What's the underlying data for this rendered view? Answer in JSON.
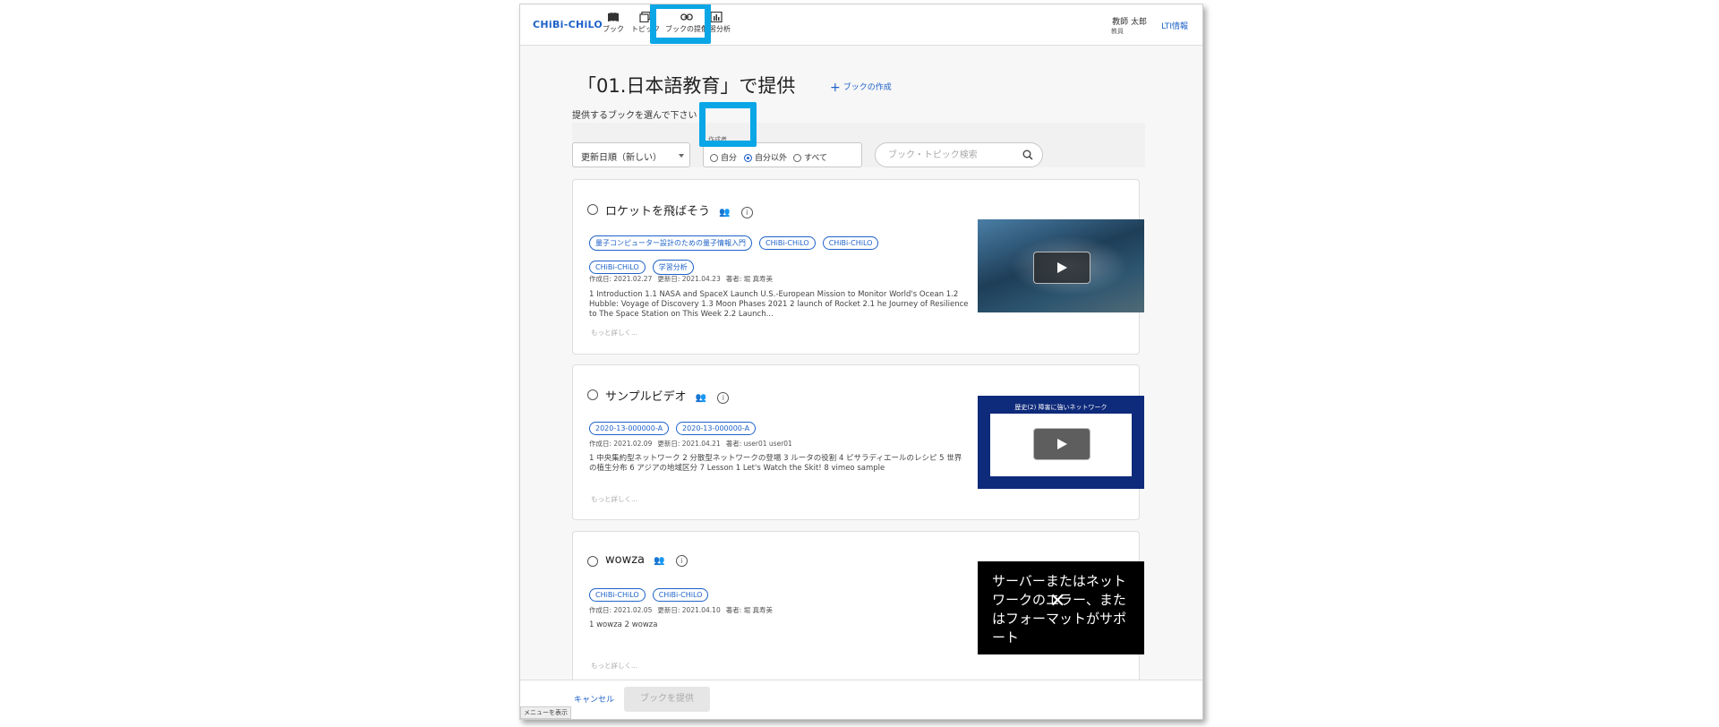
{
  "header": {
    "logo": "CHiBi-CHiLO",
    "nav": [
      "ブック",
      "トピック",
      "ブックの提供",
      "学習分析"
    ],
    "user_name": "教師 太郎",
    "user_role": "教員",
    "lti_link": "LTI情報"
  },
  "page": {
    "heading": "「01.日本語教育」で提供",
    "create_link": "ブックの作成",
    "subtitle": "提供するブックを選んで下さい"
  },
  "filters": {
    "sort_value": "更新日順（新しい）",
    "author_legend": "作成者",
    "author_options": [
      "自分",
      "自分以外",
      "すべて"
    ],
    "author_selected": "自分以外",
    "search_placeholder": "ブック・トピック検索"
  },
  "books": [
    {
      "title": "ロケットを飛ばそう",
      "tags": [
        "量子コンピューター設計のための量子情報入門",
        "CHiBi-CHiLO",
        "CHiBi-CHiLO",
        "CHiBi-CHiLO",
        "学習分析"
      ],
      "created": "作成日: 2021.02.27",
      "updated": "更新日: 2021.04.23",
      "author": "著者: 堀 真寿美",
      "description": "1 Introduction 1.1 NASA and SpaceX Launch U.S.-European Mission to Monitor World's Ocean 1.2 Hubble: Voyage of Discovery 1.3 Moon Phases 2021 2 launch of Rocket 2.1 he Journey of Resilience to The Space Station on This Week 2.2 Launch...",
      "more": "もっと詳しく..."
    },
    {
      "title": "サンプルビデオ",
      "tags": [
        "2020-13-000000-A",
        "2020-13-000000-A"
      ],
      "created": "作成日: 2021.02.09",
      "updated": "更新日: 2021.04.21",
      "author": "著者: user01 user01",
      "description": "1 中央集約型ネットワーク 2 分散型ネットワークの登場 3 ルータの役割 4 ピサラディエールのレシピ 5 世界の植生分布 6 アジアの地域区分 7 Lesson 1 Let's Watch the Skit! 8 vimeo sample",
      "more": "もっと詳しく...",
      "thumb_caption": "歴史(2) 障害に強いネットワーク"
    },
    {
      "title": "wowza",
      "tags": [
        "CHiBi-CHiLO",
        "CHiBi-CHiLO"
      ],
      "created": "作成日: 2021.02.05",
      "updated": "更新日: 2021.04.10",
      "author": "著者: 堀 真寿美",
      "description": "1 wowza 2 wowza",
      "more": "もっと詳しく...",
      "thumb_error": "サーバーまたはネットワークのエラー、またはフォーマットがサポート"
    }
  ],
  "footer": {
    "cancel": "キャンセル",
    "provide": "ブックを提供",
    "menu_tab": "メニューを表示"
  },
  "colors": {
    "accent": "#1e62c8",
    "highlight": "#0aa6e6"
  }
}
